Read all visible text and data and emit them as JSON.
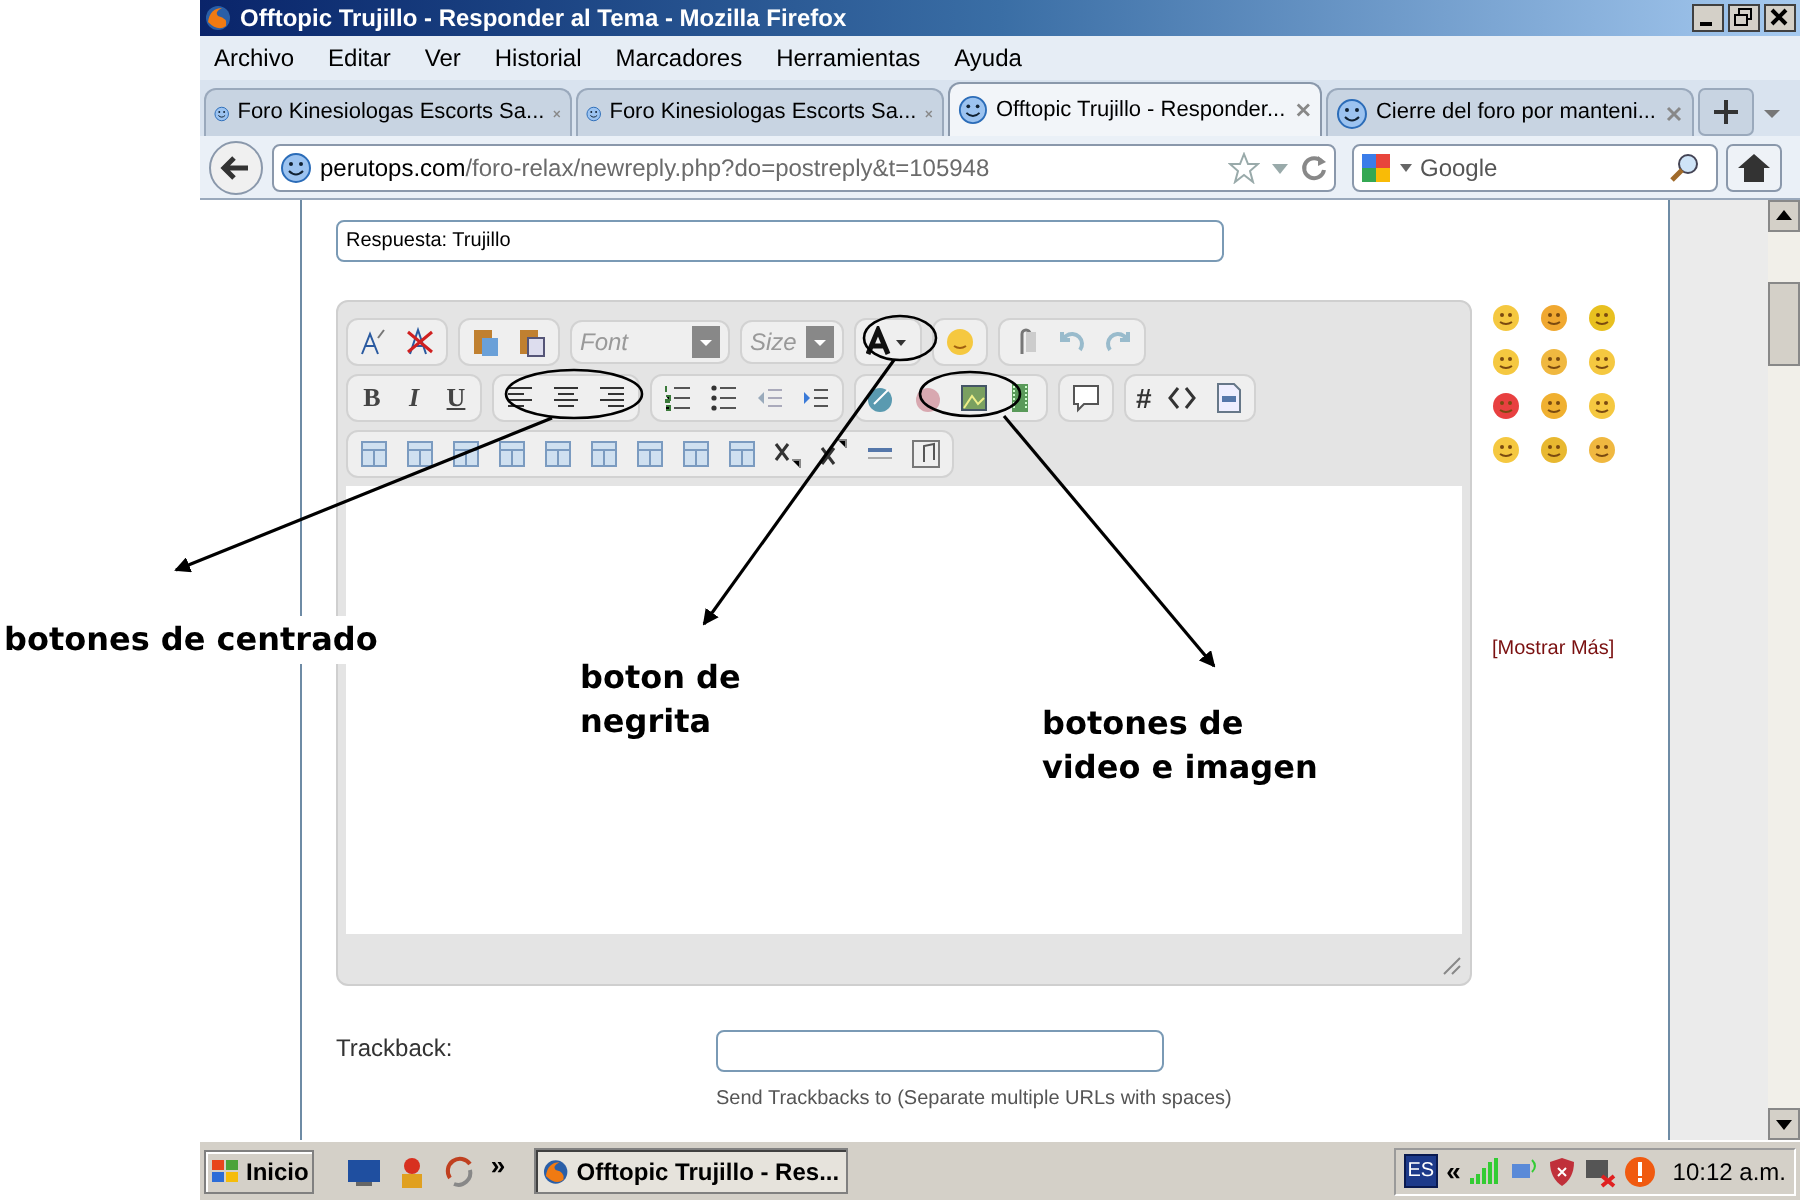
{
  "window": {
    "title": "Offtopic Trujillo - Responder al Tema - Mozilla Firefox"
  },
  "menu": [
    "Archivo",
    "Editar",
    "Ver",
    "Historial",
    "Marcadores",
    "Herramientas",
    "Ayuda"
  ],
  "tabs": [
    {
      "label": "Foro Kinesiologas Escorts Sa...",
      "selected": false
    },
    {
      "label": "Foro Kinesiologas Escorts Sa...",
      "selected": false
    },
    {
      "label": "Offtopic Trujillo - Responder...",
      "selected": true
    },
    {
      "label": "Cierre del foro por manteni...",
      "selected": false
    }
  ],
  "address": {
    "domain": "perutops.com",
    "path": "/foro-relax/newreply.php?do=postreply&t=105948"
  },
  "search": {
    "placeholder": "Google"
  },
  "form": {
    "title_value": "Respuesta: Trujillo",
    "font_placeholder": "Font",
    "size_placeholder": "Size",
    "format_buttons": [
      "B",
      "I",
      "U"
    ],
    "hash_button": "#",
    "more_link": "[Mostrar Más]",
    "trackback_label": "Trackback:",
    "trackback_hint": "Send Trackbacks to (Separate multiple URLs with spaces)"
  },
  "taskbar": {
    "start": "Inicio",
    "overflow": "»",
    "task": "Offtopic Trujillo - Res...",
    "language": "ES",
    "tray_overflow": "«",
    "clock": "10:12 a.m."
  },
  "annotations": [
    {
      "text": "botones de centrado"
    },
    {
      "text": "boton de negrita"
    },
    {
      "text": "botones de video e imagen"
    }
  ]
}
